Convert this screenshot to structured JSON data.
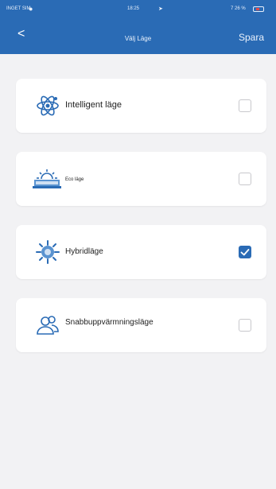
{
  "status_bar": {
    "carrier": "INGET SIM",
    "time": "18:25",
    "battery": "7 26 %"
  },
  "nav": {
    "back_label": "<",
    "title": "Välj Läge",
    "save_label": "Spara"
  },
  "modes": [
    {
      "label": "Intelligent läge",
      "icon": "atom-icon",
      "checked": false
    },
    {
      "label": "Eco läge",
      "icon": "eco-sun-house-icon",
      "checked": false
    },
    {
      "label": "Hybridläge",
      "icon": "sun-gear-icon",
      "checked": true
    },
    {
      "label": "Snabbuppvärmningsläge",
      "icon": "users-icon",
      "checked": false
    }
  ],
  "colors": {
    "appbar": "#2a6bb5",
    "background": "#f2f2f4",
    "checkbox_checked": "#2a6bb5"
  }
}
